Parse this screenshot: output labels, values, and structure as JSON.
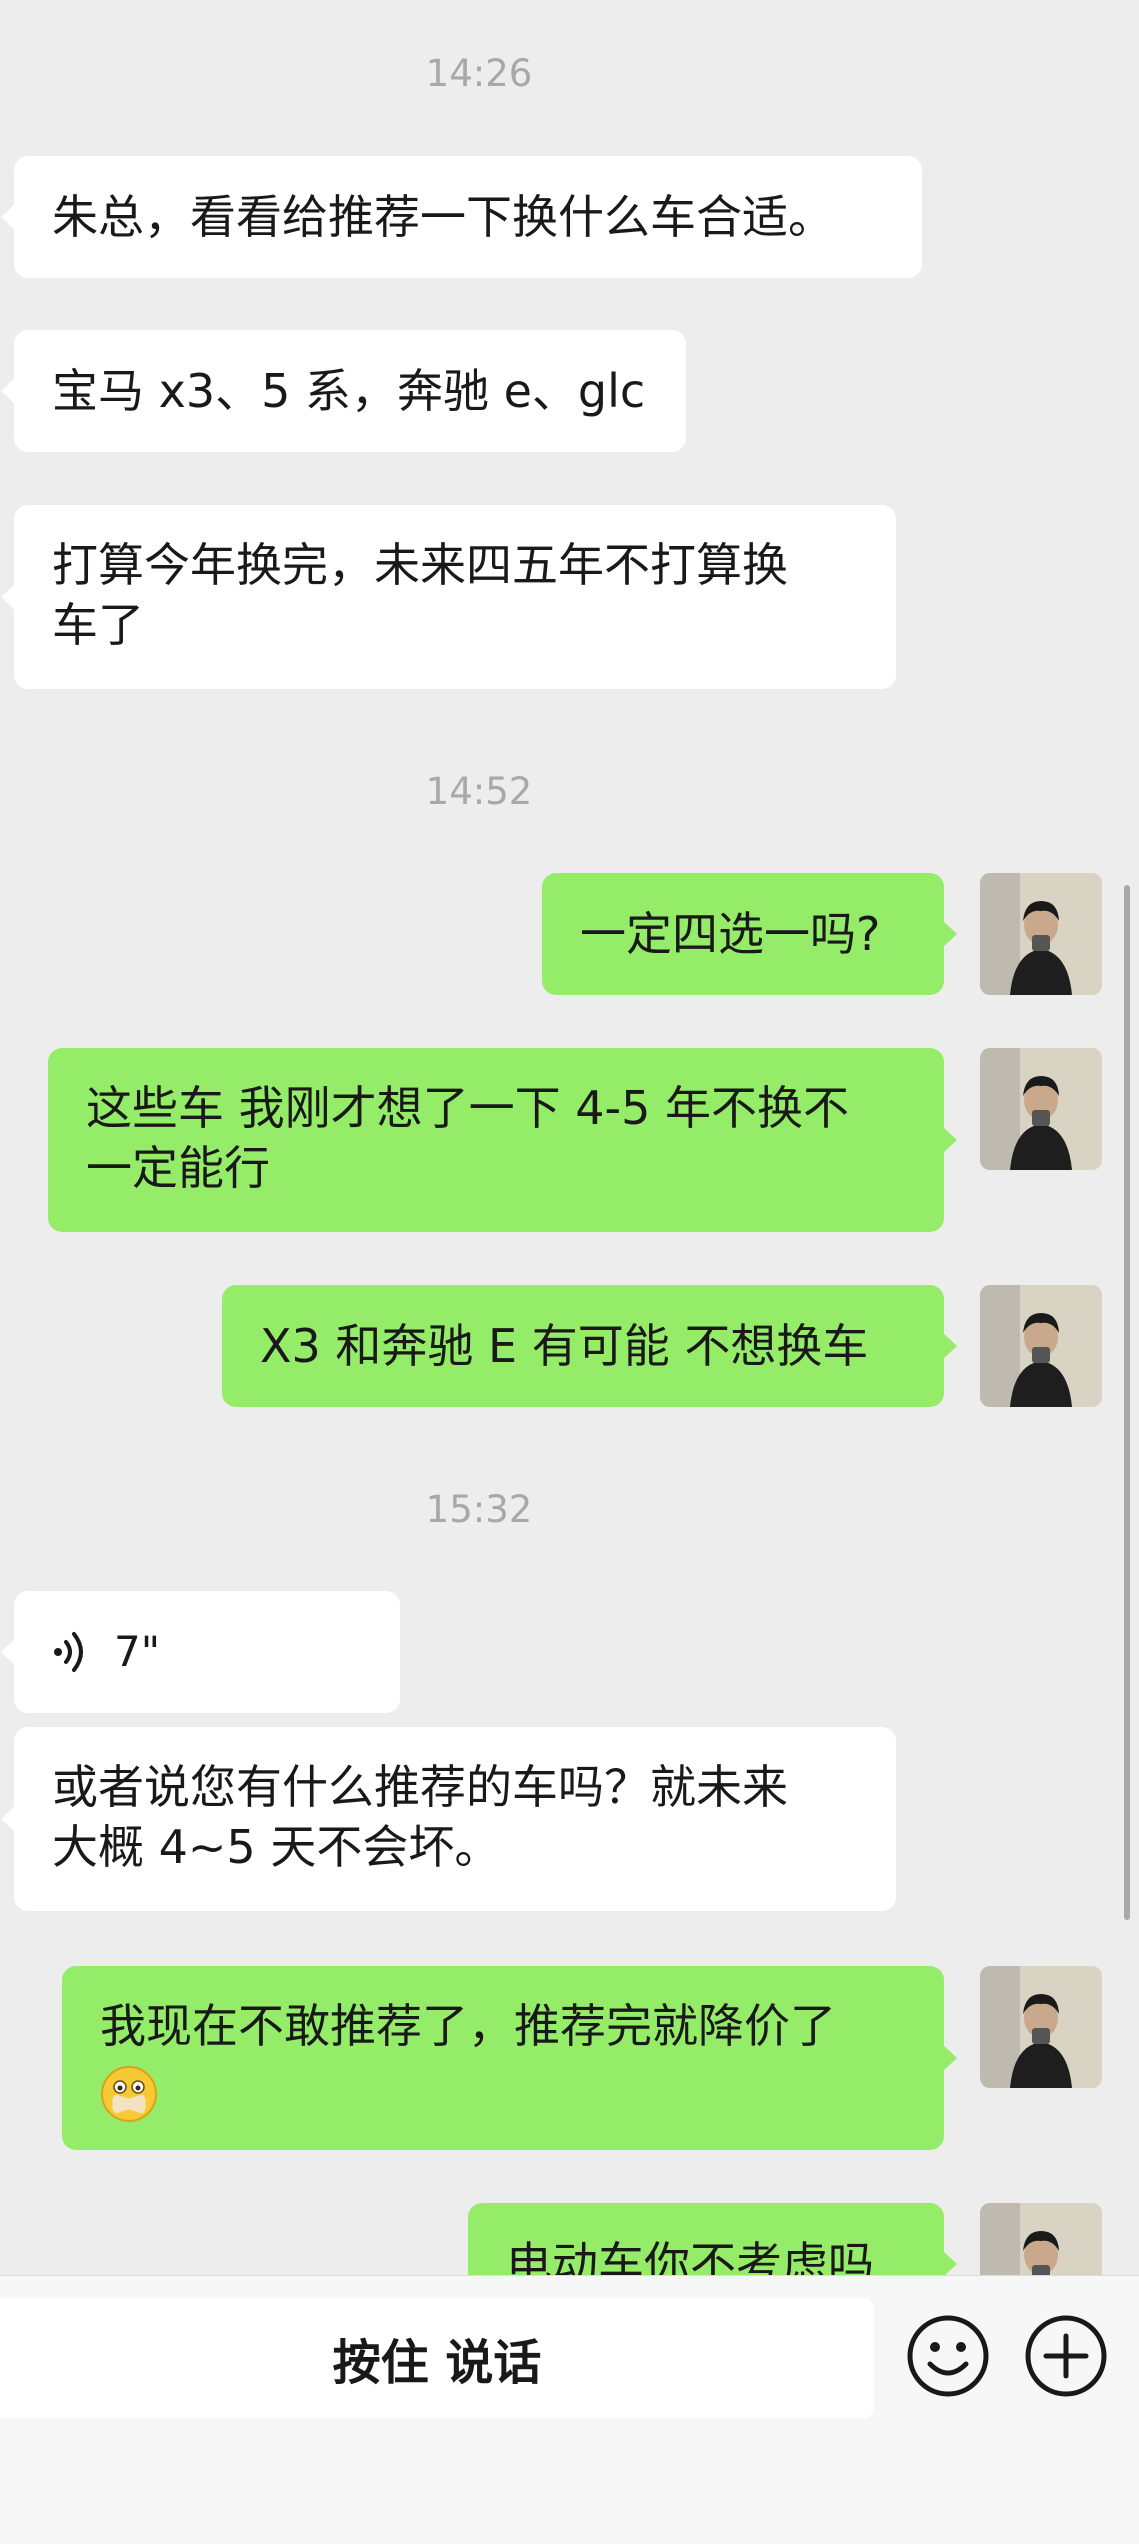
{
  "timestamps": [
    "14:26",
    "14:52",
    "15:32"
  ],
  "messages": {
    "m1": "朱总，看看给推荐一下换什么车合适。",
    "m2": "宝马 x3、5 系，奔驰 e、glc",
    "m3_line1": "打算今年换完，未来四五年不打算换",
    "m3_line2": "车了",
    "m4": "一定四选一吗?",
    "m5_line1": "这些车 我刚才想了一下 4-5 年不换不",
    "m5_line2": "一定能行",
    "m6": "X3 和奔驰 E 有可能 不想换车",
    "voice_duration": "7\"",
    "m8_line1": "或者说您有什么推荐的车吗？就未来",
    "m8_line2": "大概 4~5 天不会坏。",
    "m9_line1": "我现在不敢推荐了，推荐完就降价了",
    "m10": "电动车你不考虑吗"
  },
  "input_bar": {
    "hold_to_talk": "按住 说话"
  },
  "icons": {
    "voice": "voice-wave-icon",
    "emoji_button": "smiley-icon",
    "more_button": "plus-circle-icon",
    "inline_emoji": "shut-mouth-emoji"
  },
  "colors": {
    "background": "#ededed",
    "incoming_bubble": "#ffffff",
    "outgoing_bubble": "#95ec69",
    "timestamp": "#a8a8a8"
  }
}
